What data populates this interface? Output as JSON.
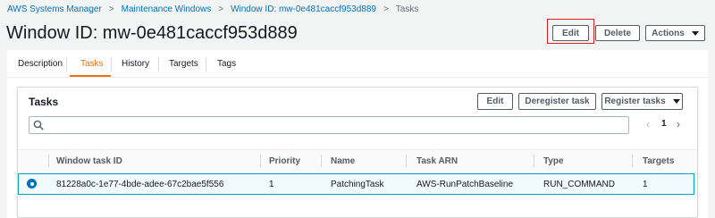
{
  "breadcrumb": {
    "items": [
      "AWS Systems Manager",
      "Maintenance Windows",
      "Window ID: mw-0e481caccf953d889"
    ],
    "current": "Tasks",
    "separator": ">"
  },
  "page": {
    "title": "Window ID: mw-0e481caccf953d889"
  },
  "header_actions": {
    "edit_label": "Edit",
    "delete_label": "Delete",
    "actions_label": "Actions"
  },
  "tabs": [
    {
      "label": "Description",
      "active": false
    },
    {
      "label": "Tasks",
      "active": true
    },
    {
      "label": "History",
      "active": false
    },
    {
      "label": "Targets",
      "active": false
    },
    {
      "label": "Tags",
      "active": false
    }
  ],
  "tasks_panel": {
    "title": "Tasks",
    "edit_label": "Edit",
    "deregister_label": "Deregister task",
    "register_label": "Register tasks",
    "search_placeholder": "",
    "current_page": "1",
    "prev_glyph": "‹",
    "next_glyph": "›",
    "columns": [
      "Window task ID",
      "Priority",
      "Name",
      "Task ARN",
      "Type",
      "Targets"
    ],
    "rows": [
      {
        "selected": true,
        "window_task_id": "81228a0c-1e77-4bde-adee-67c2bae5f556",
        "priority": "1",
        "name": "PatchingTask",
        "task_arn": "AWS-RunPatchBaseline",
        "type": "RUN_COMMAND",
        "targets": "1"
      }
    ]
  },
  "colors": {
    "link": "#0073bb",
    "active_tab": "#ec7211",
    "highlight_box": "#d81e1e",
    "selected_row_border": "#00a1c9"
  }
}
